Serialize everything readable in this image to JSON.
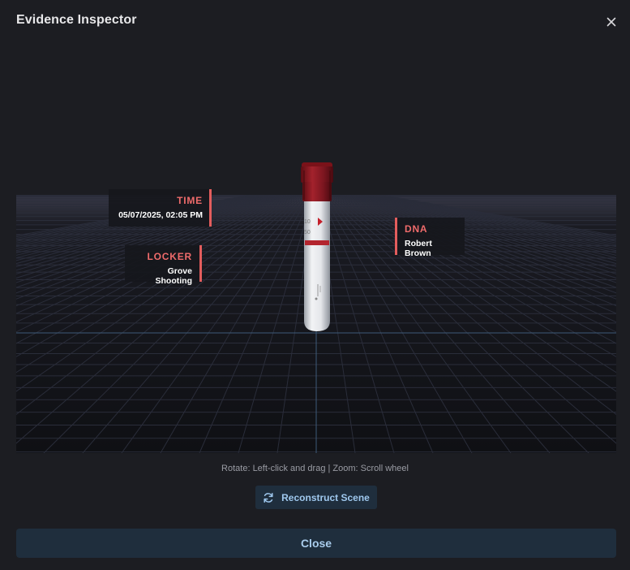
{
  "dialog": {
    "title": "Evidence Inspector"
  },
  "tags": {
    "time": {
      "label": "TIME",
      "value": "05/07/2025, 02:05 PM"
    },
    "locker": {
      "label": "LOCKER",
      "value": "Grove Shooting"
    },
    "dna": {
      "label": "DNA",
      "value": "Robert Brown"
    }
  },
  "tube": {
    "markings": [
      "10",
      "50"
    ],
    "cap_color": "#8e1a22"
  },
  "hint": "Rotate: Left-click and drag | Zoom: Scroll wheel",
  "buttons": {
    "reconstruct": "Reconstruct Scene",
    "close": "Close"
  },
  "colors": {
    "accent_red": "#e35d5d",
    "button_bg": "#1f2e3d",
    "button_text": "#9fc8ee",
    "background": "#1c1d22"
  }
}
